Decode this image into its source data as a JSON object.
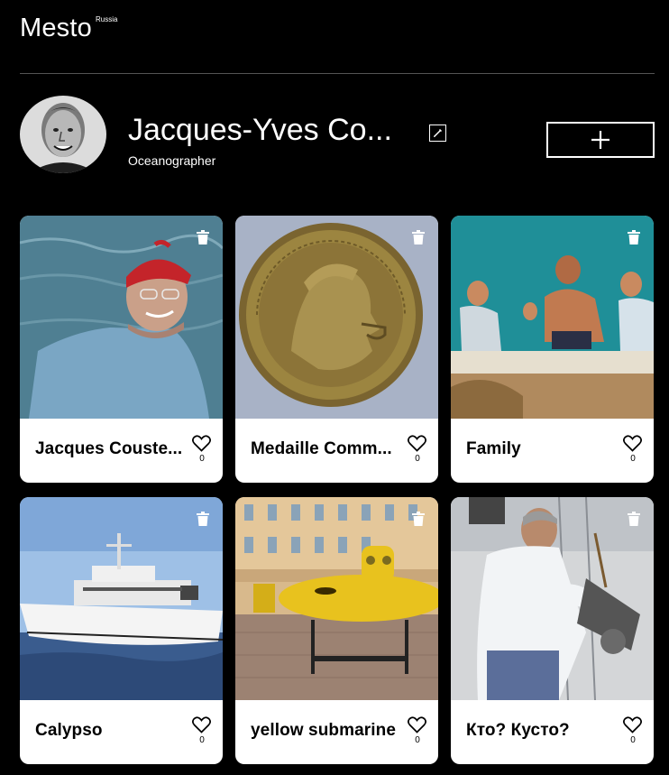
{
  "header": {
    "logo": "Mesto",
    "logo_sup": "Russia"
  },
  "profile": {
    "name": "Jacques-Yves Co...",
    "about": "Oceanographer"
  },
  "cards": [
    {
      "title": "Jacques Couste...",
      "likes": "0",
      "photo": "man-in-red-cap"
    },
    {
      "title": "Medaille Comm...",
      "likes": "0",
      "photo": "bronze-medal"
    },
    {
      "title": "Family",
      "likes": "0",
      "photo": "family-on-boat"
    },
    {
      "title": "Calypso",
      "likes": "0",
      "photo": "ship-at-sea"
    },
    {
      "title": "yellow submarine",
      "likes": "0",
      "photo": "yellow-submarine"
    },
    {
      "title": "Кто? Кусто?",
      "likes": "0",
      "photo": "man-with-equipment"
    }
  ],
  "icons": {
    "edit": "pencil-icon",
    "add": "plus-icon",
    "delete": "trash-icon",
    "like": "heart-icon"
  }
}
